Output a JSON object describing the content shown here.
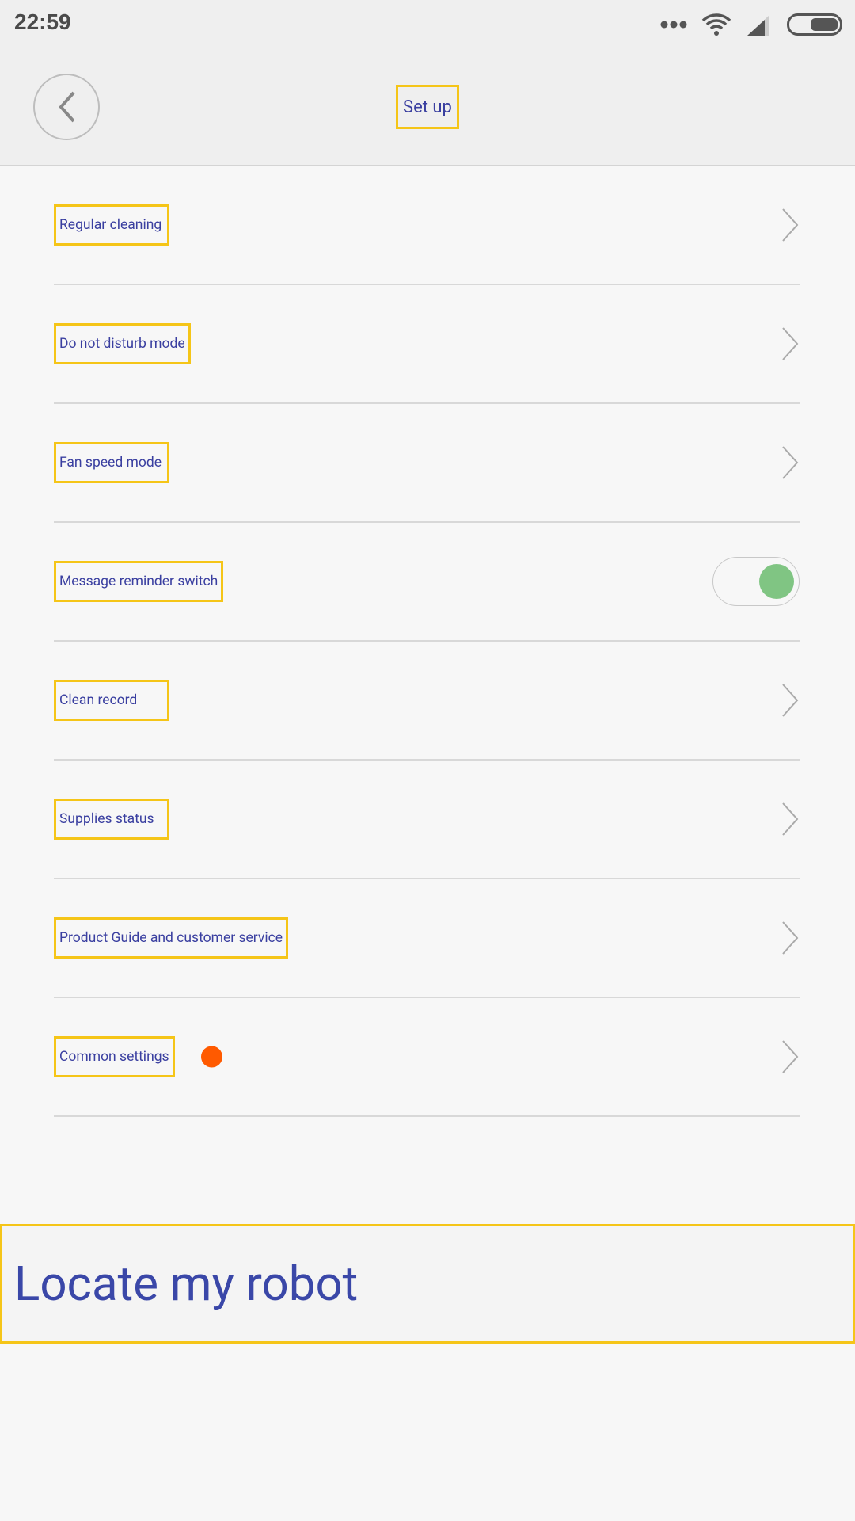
{
  "status_bar": {
    "time": "22:59",
    "icons": [
      "more-dots-icon",
      "wifi-icon",
      "signal-icon",
      "battery-icon"
    ]
  },
  "header": {
    "title": "Set up",
    "back_icon": "chevron-left-icon"
  },
  "settings": [
    {
      "label": "Regular cleaning",
      "type": "link"
    },
    {
      "label": "Do not disturb mode",
      "type": "link"
    },
    {
      "label": "Fan speed mode",
      "type": "link"
    },
    {
      "label": "Message reminder switch",
      "type": "toggle",
      "on": true
    },
    {
      "label": "Clean record",
      "type": "link"
    },
    {
      "label": "Supplies status",
      "type": "link"
    },
    {
      "label": "Product Guide and customer service",
      "type": "link"
    },
    {
      "label": "Common settings",
      "type": "link",
      "badge": true
    }
  ],
  "locate_button": {
    "label": "Locate my robot"
  },
  "colors": {
    "accent_text": "#3a3fa0",
    "toggle_on": "#80c583",
    "badge": "#ff5a00",
    "highlight_box": "#f5c518"
  }
}
